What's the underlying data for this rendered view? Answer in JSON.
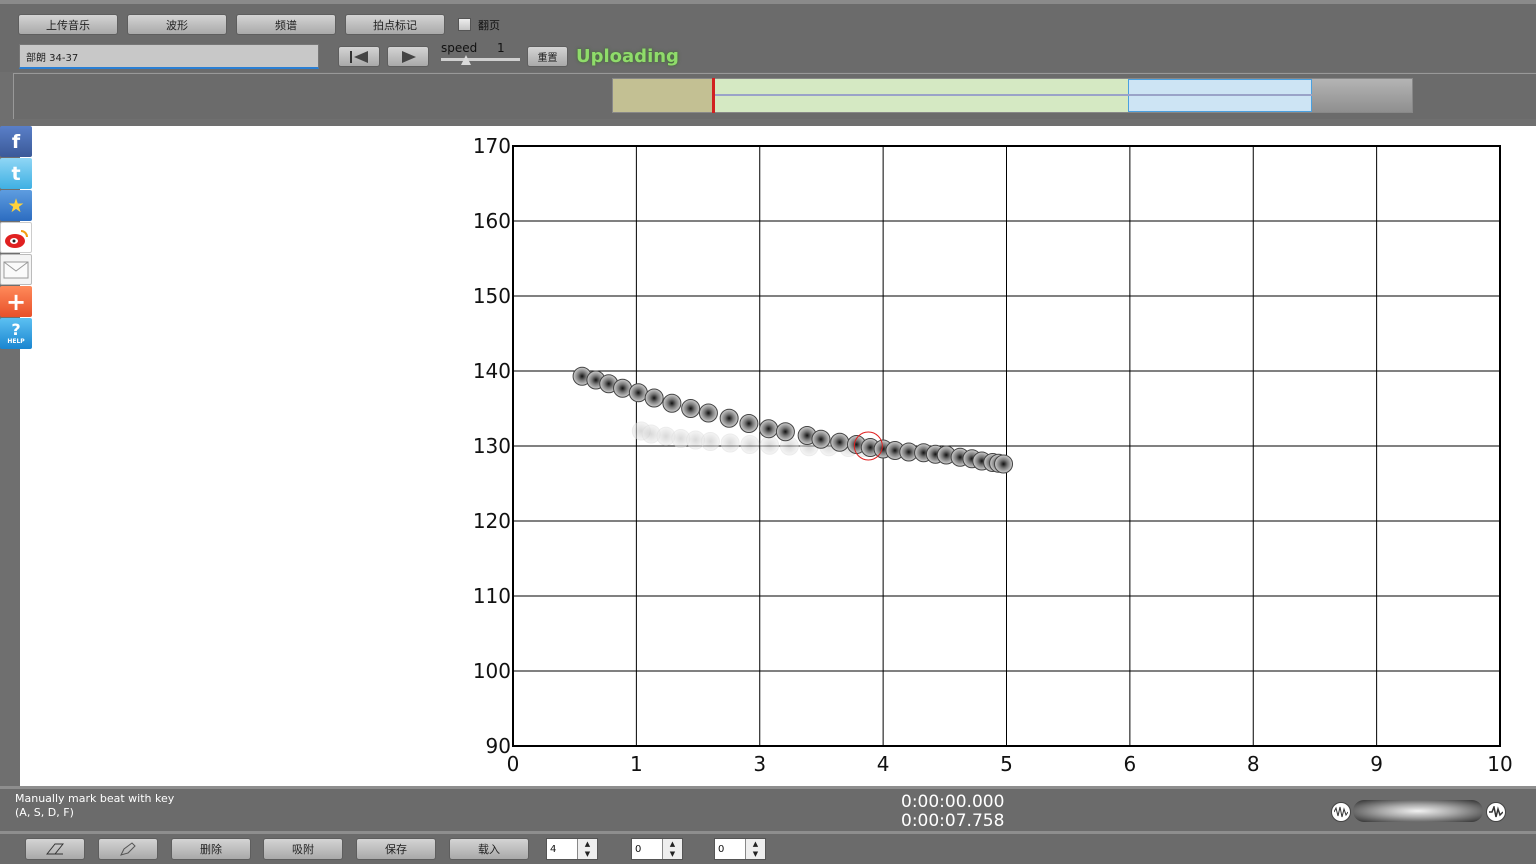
{
  "toolbar": {
    "upload_music": "上传音乐",
    "waveform": "波形",
    "spectrum": "频谱",
    "beat_marks": "拍点标记",
    "page_flip_label": "翻页",
    "page_flip_checked": false,
    "title_value": "部朗 34-37",
    "speed_label": "speed",
    "speed_value": "1",
    "speed_fraction": 0.32,
    "reset_label": "重置",
    "status": "Uploading"
  },
  "waveform": {
    "played_fraction": 0.125,
    "buffered_fraction": 0.645,
    "selection_end_fraction": 0.875
  },
  "sidebar": {
    "icons": [
      "facebook-icon",
      "twitter-icon",
      "favorite-star-icon",
      "weibo-icon",
      "mail-icon",
      "add-more-icon",
      "help-icon"
    ],
    "help_text": "HELP"
  },
  "status": {
    "hint_line1": "Manually mark beat with key",
    "hint_line2": "(A, S, D, F)",
    "time_current": "0:00:00.000",
    "time_total": "0:00:07.758"
  },
  "bottom": {
    "eraser_icon": "eraser-icon",
    "pen_icon": "pen-icon",
    "delete": "删除",
    "snap": "吸附",
    "save": "保存",
    "load": "载入",
    "spin1": "4",
    "spin2": "0",
    "spin3": "0"
  },
  "chart_data": {
    "type": "scatter",
    "title": "",
    "xlabel": "",
    "ylabel": "",
    "xlim": [
      0,
      10
    ],
    "ylim": [
      90,
      170
    ],
    "x_ticks": [
      "0",
      "1",
      "3",
      "4",
      "5",
      "6",
      "8",
      "9",
      "10"
    ],
    "y_ticks": [
      "90",
      "100",
      "110",
      "120",
      "130",
      "140",
      "150",
      "160",
      "170"
    ],
    "grid": true,
    "series": [
      {
        "x": [
          0.7,
          0.84,
          0.97,
          1.11,
          1.27,
          1.43,
          1.61,
          1.8,
          1.98,
          2.19,
          2.39,
          2.59,
          2.76,
          2.98,
          3.12,
          3.31,
          3.48,
          3.62,
          3.75,
          3.87,
          4.01,
          4.16,
          4.28,
          4.39,
          4.53,
          4.65,
          4.75,
          4.86,
          4.92,
          4.97
        ],
        "y": [
          139.3,
          138.8,
          138.3,
          137.7,
          137.1,
          136.4,
          135.7,
          135.0,
          134.4,
          133.7,
          133.0,
          132.3,
          131.9,
          131.4,
          130.9,
          130.5,
          130.2,
          129.8,
          129.6,
          129.4,
          129.2,
          129.1,
          128.9,
          128.8,
          128.5,
          128.3,
          128.0,
          127.8,
          127.7,
          127.6
        ]
      },
      {
        "x": [
          1.3,
          1.4,
          1.55,
          1.7,
          1.85,
          2.0,
          2.2,
          2.4,
          2.6,
          2.8,
          3.0,
          3.2,
          3.4,
          3.55
        ],
        "y": [
          132.0,
          131.6,
          131.3,
          131.0,
          130.8,
          130.6,
          130.4,
          130.2,
          130.1,
          130.0,
          129.9,
          129.9,
          129.8,
          129.8
        ]
      }
    ],
    "cursor": {
      "x": 3.6,
      "y": 130.0
    }
  }
}
